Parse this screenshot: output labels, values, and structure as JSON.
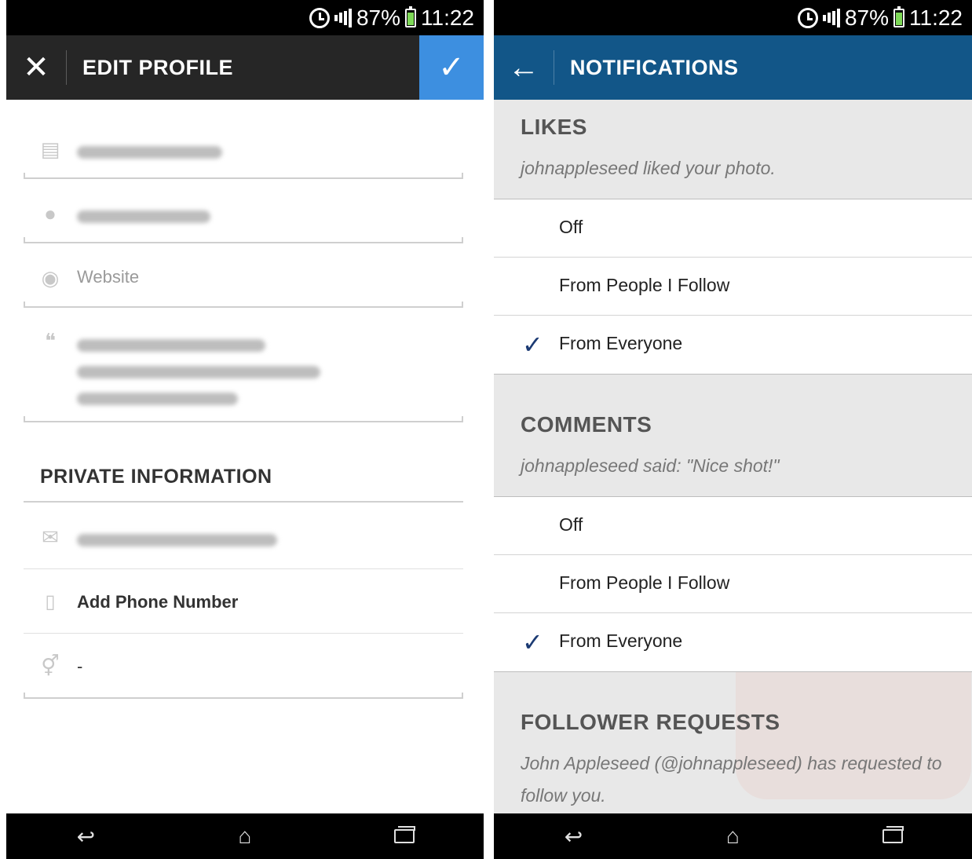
{
  "status": {
    "battery": "87%",
    "time": "11:22"
  },
  "edit_profile": {
    "title": "EDIT PROFILE",
    "website_placeholder": "Website",
    "private_section": "PRIVATE INFORMATION",
    "add_phone": "Add Phone Number",
    "gender_value": "-"
  },
  "notifications": {
    "title": "NOTIFICATIONS",
    "likes": {
      "heading": "LIKES",
      "example": "johnappleseed liked your photo.",
      "options": [
        "Off",
        "From People I Follow",
        "From Everyone"
      ],
      "selected": "From Everyone"
    },
    "comments": {
      "heading": "COMMENTS",
      "example": "johnappleseed said: \"Nice shot!\"",
      "options": [
        "Off",
        "From People I Follow",
        "From Everyone"
      ],
      "selected": "From Everyone"
    },
    "follower_requests": {
      "heading": "FOLLOWER REQUESTS",
      "example": "John Appleseed (@johnappleseed) has requested to follow you."
    }
  },
  "nav": {
    "back_icon": "back-icon",
    "home_icon": "home-icon",
    "recent_icon": "recent-apps-icon"
  },
  "colors": {
    "edit_bar": "#262626",
    "confirm": "#3d8fe0",
    "notif_bar": "#125688",
    "check": "#1b3a73"
  }
}
